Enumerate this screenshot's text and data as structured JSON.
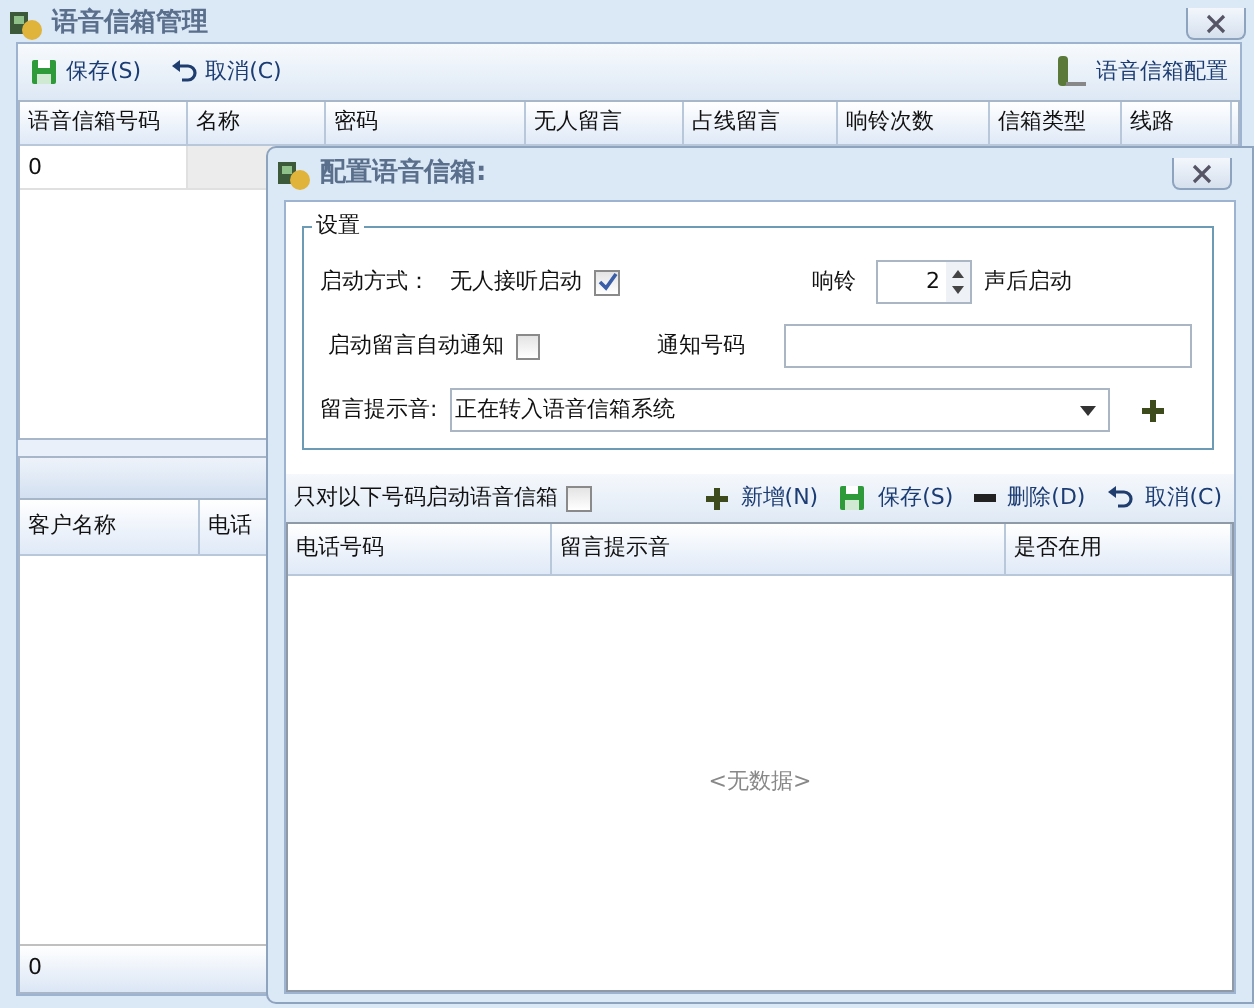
{
  "window": {
    "title": "语音信箱管理"
  },
  "toolbar": {
    "buttons": [
      {
        "label": "保存(S)",
        "kind": "save"
      },
      {
        "label": "取消(C)",
        "kind": "undo"
      }
    ],
    "config_button": "语音信箱配置"
  },
  "mailbox_table": {
    "columns": [
      "语音信箱号码",
      "名称",
      "密码",
      "无人留言",
      "占线留言",
      "响铃次数",
      "信箱类型",
      "线路"
    ],
    "rows": [
      [
        "0"
      ]
    ]
  },
  "customer_table": {
    "columns": [
      "客户名称",
      "电话"
    ],
    "footer": "0"
  },
  "dialog": {
    "title": "配置语音信箱:",
    "settings": {
      "legend": "设置",
      "start_mode_label": "启动方式：",
      "unanswered": {
        "label": "无人接听启动",
        "checked": true
      },
      "ring_label": "响铃",
      "ring_count": "2",
      "ring_suffix": "声后启动",
      "auto_notify": {
        "label": "启动留言自动通知",
        "checked": false
      },
      "notify_label": "通知号码",
      "prompt_label": "留言提示音:",
      "prompt_value": "正在转入语音信箱系统"
    },
    "number_filter": {
      "label": "只对以下号码启动语音信箱",
      "checked": false
    },
    "buttons": [
      {
        "label": "新增(N)",
        "kind": "add"
      },
      {
        "label": "保存(S)",
        "kind": "save"
      },
      {
        "label": "删除(D)",
        "kind": "delete"
      },
      {
        "label": "取消(C)",
        "kind": "undo"
      }
    ],
    "table": {
      "columns": [
        "电话号码",
        "留言提示音",
        "是否在用"
      ],
      "empty_text": "<无数据>"
    }
  }
}
